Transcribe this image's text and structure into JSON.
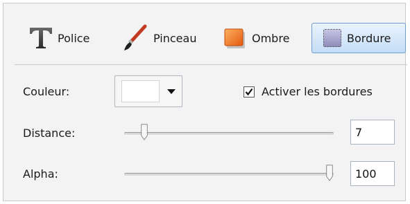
{
  "tabs": [
    {
      "label": "Police",
      "icon": "font-t-icon"
    },
    {
      "label": "Pinceau",
      "icon": "paintbrush-icon"
    },
    {
      "label": "Ombre",
      "icon": "shadow-square-icon"
    },
    {
      "label": "Bordure",
      "icon": "border-square-icon",
      "active": true
    }
  ],
  "color": {
    "label": "Couleur:",
    "value": "#ffffff"
  },
  "enable_borders": {
    "label": "Activer les bordures",
    "checked": true
  },
  "distance": {
    "label": "Distance:",
    "value": "7",
    "slider_fraction": 0.08
  },
  "alpha": {
    "label": "Alpha:",
    "value": "100",
    "slider_fraction": 1.0
  }
}
